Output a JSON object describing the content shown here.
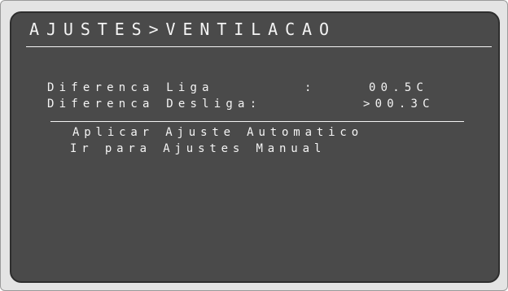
{
  "screen": {
    "title": "AJUSTES>VENTILACAO",
    "params": [
      {
        "label": "Diferenca Liga",
        "separator": ":",
        "value": "00.5C"
      },
      {
        "label": "Diferenca Desliga:",
        "value": ">00.3C"
      }
    ],
    "menu": [
      "Aplicar Ajuste Automatico",
      "Ir para Ajustes Manual"
    ]
  }
}
